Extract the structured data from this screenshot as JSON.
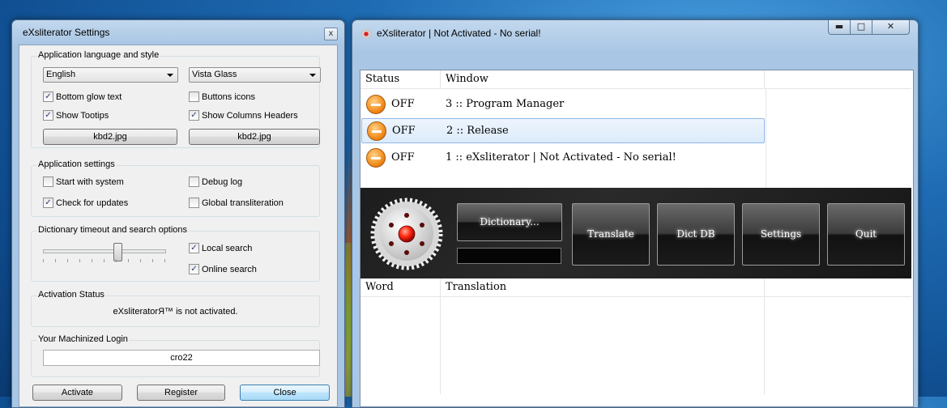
{
  "settings_window": {
    "title": "eXsliterator Settings",
    "close_glyph": "x",
    "language_group": {
      "title": "Application language and style",
      "language_value": "English",
      "style_value": "Vista Glass",
      "bottom_glow_text": "Bottom glow text",
      "bottom_glow_text_checked": true,
      "buttons_icons": "Buttons icons",
      "buttons_icons_checked": false,
      "show_tooltips": "Show Tootips",
      "show_tooltips_checked": true,
      "show_columns_headers": "Show Columns Headers",
      "show_columns_headers_checked": true,
      "image_button_left": "kbd2.jpg",
      "image_button_right": "kbd2.jpg"
    },
    "app_settings_group": {
      "title": "Application settings",
      "start_with_system": "Start with system",
      "start_with_system_checked": false,
      "debug_log": "Debug log",
      "debug_log_checked": false,
      "check_for_updates": "Check for updates",
      "check_for_updates_checked": true,
      "global_transliteration": "Global transliteration",
      "global_transliteration_checked": false
    },
    "dictionary_group": {
      "title": "Dictionary timeout and search options",
      "timeout_slider_fraction": 0.6,
      "local_search": "Local search",
      "local_search_checked": true,
      "online_search": "Online search",
      "online_search_checked": true
    },
    "activation_group": {
      "title": "Activation Status",
      "status_text": "eXsliteratorЯ™ is not activated."
    },
    "login_group": {
      "title": "Your Machinized Login",
      "login_value": "cro22"
    },
    "buttons": {
      "activate": "Activate",
      "register": "Register",
      "close": "Close"
    }
  },
  "main_window": {
    "title": "eXsliterator | Not Activated - No serial!",
    "caption": {
      "minimize": "▬",
      "maximize": "□",
      "close": "✕"
    },
    "window_list": {
      "headers": {
        "status": "Status",
        "window": "Window"
      },
      "rows": [
        {
          "status": "OFF",
          "window": "3 :: Program Manager",
          "selected": false
        },
        {
          "status": "OFF",
          "window": "2 :: Release",
          "selected": true
        },
        {
          "status": "OFF",
          "window": "1 :: eXsliterator | Not Activated - No serial!",
          "selected": false
        }
      ]
    },
    "toolbar": {
      "dictionary": "Dictionary...",
      "translate": "Translate",
      "dict_db": "Dict DB",
      "settings": "Settings",
      "quit": "Quit",
      "dictionary_field_value": ""
    },
    "translation_list": {
      "headers": {
        "word": "Word",
        "translation": "Translation"
      }
    }
  },
  "colors": {
    "desktop_blue": "#1f6cb4",
    "window_frame": "#a9c6e4",
    "status_off_orange": "#f28c1b",
    "selection_blue": "#dcebfc",
    "toolbar_black": "#1d1d1d"
  }
}
